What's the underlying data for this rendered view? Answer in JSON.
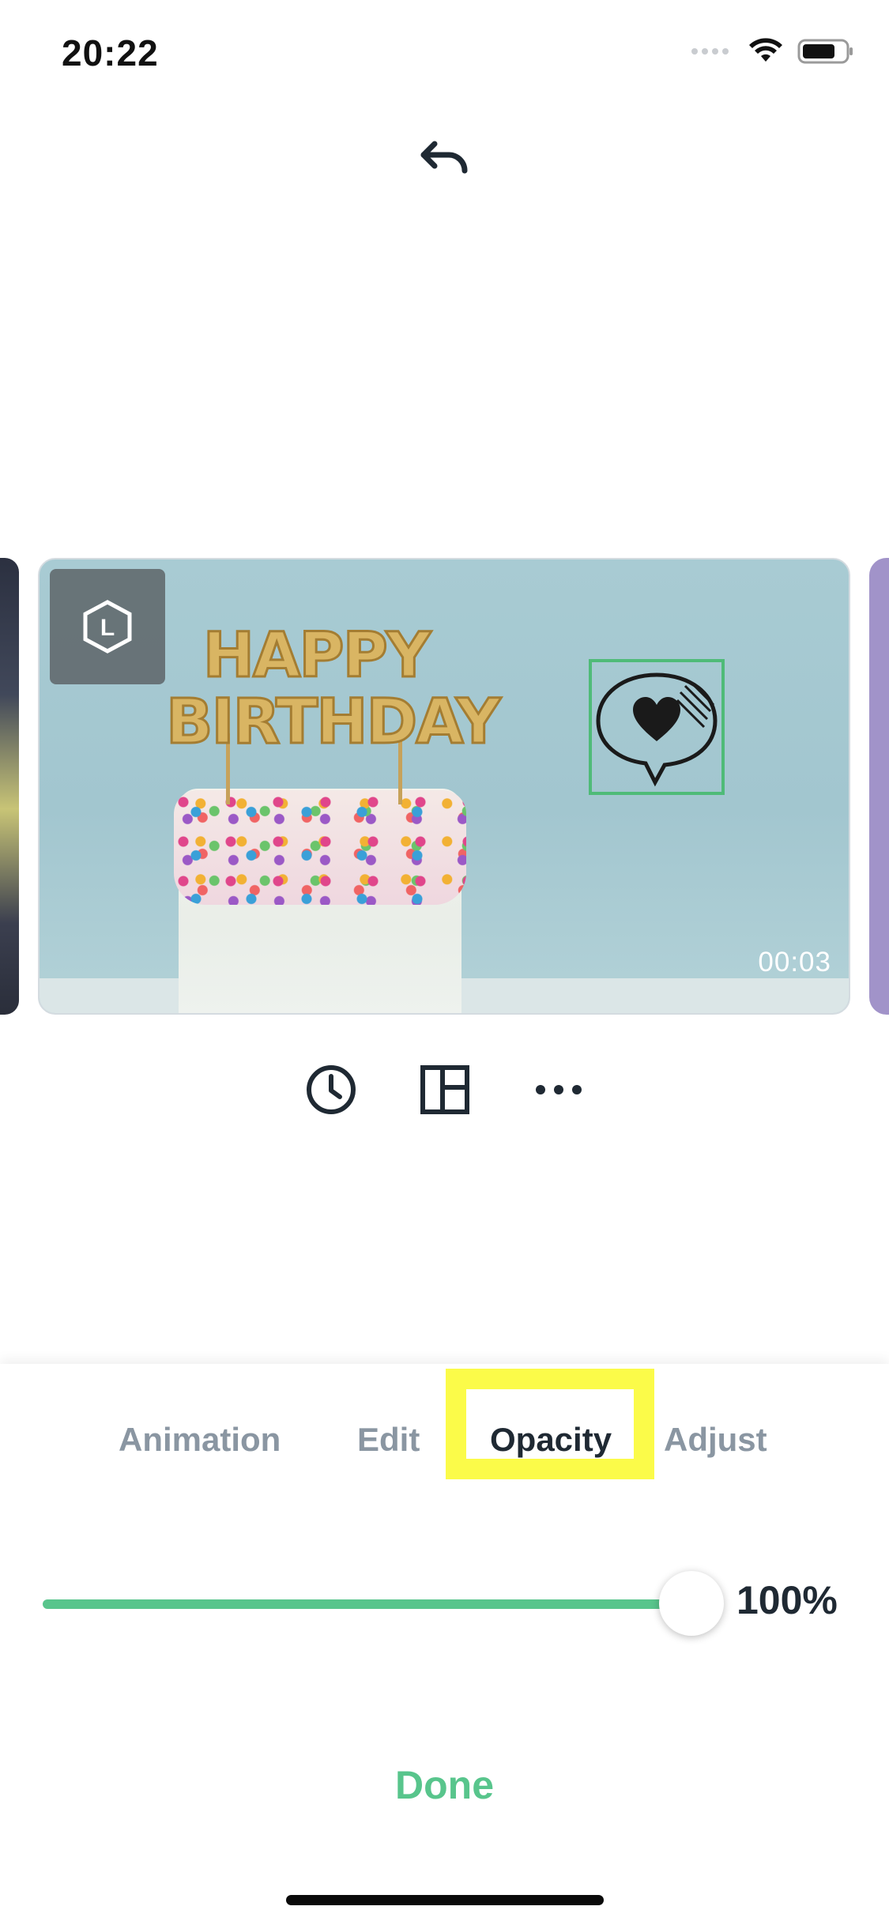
{
  "status_bar": {
    "time": "20:22",
    "battery_level": 0.75,
    "wifi": "wifi-icon",
    "signal": "cellular-signal-icon"
  },
  "header": {
    "undo_icon": "undo-icon"
  },
  "slide": {
    "duration": "00:03",
    "logo_badge_letter": "L",
    "sticker": "heart-speech-bubble-sticker",
    "image_text_top": "HAPPY",
    "image_text_bottom": "BIRTHDAY",
    "selection_color": "#4fbb78"
  },
  "toolbar": {
    "icons": [
      "clock-icon",
      "layout-icon",
      "more-icon"
    ]
  },
  "tabs": [
    {
      "label": "Animation",
      "active": false
    },
    {
      "label": "Edit",
      "active": false
    },
    {
      "label": "Opacity",
      "active": true
    },
    {
      "label": "Adjust",
      "active": false
    }
  ],
  "opacity": {
    "value": 1.0,
    "label": "100%"
  },
  "done_label": "Done",
  "colors": {
    "accent": "#58c58c",
    "highlight": "#fbfb49",
    "text": "#1f2933",
    "muted": "#8a96a2"
  }
}
